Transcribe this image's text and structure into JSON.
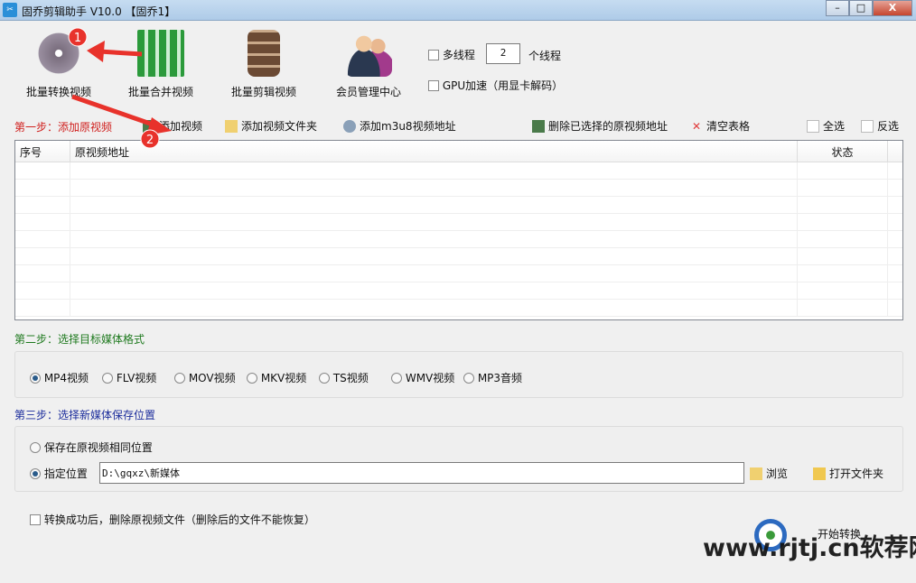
{
  "window": {
    "title": "固乔剪辑助手 V10.0 【固乔1】",
    "app_icon": "scissors-icon",
    "min": "–",
    "max": "□",
    "close": "X"
  },
  "tools": [
    {
      "label": "批量转换视频",
      "icon": "film-reel-convert-icon",
      "color": "#7a6e7e"
    },
    {
      "label": "批量合并视频",
      "icon": "merge-blocks-icon",
      "color": "#2b9a3b"
    },
    {
      "label": "批量剪辑视频",
      "icon": "film-strip-cut-icon",
      "color": "#6b4a34"
    },
    {
      "label": "会员管理中心",
      "icon": "members-icon",
      "color": "#3a6aa8"
    }
  ],
  "options": {
    "multithread_label": "多线程",
    "thread_count": "2",
    "thread_unit": "个线程",
    "gpu_label": "GPU加速（用显卡解码）"
  },
  "step1": {
    "title": "第一步：添加原视频",
    "add_video": "添加视频",
    "add_folder": "添加视频文件夹",
    "add_m3u8": "添加m3u8视频地址",
    "delete_selected": "删除已选择的原视频地址",
    "clear_table": "清空表格",
    "select_all": "全选",
    "invert": "反选"
  },
  "table": {
    "columns": [
      "序号",
      "原视频地址",
      "状态"
    ],
    "rows": []
  },
  "step2": {
    "title": "第二步：选择目标媒体格式",
    "formats": [
      "MP4视频",
      "FLV视频",
      "MOV视频",
      "MKV视频",
      "TS视频",
      "WMV视频",
      "MP3音频"
    ],
    "selected": 0
  },
  "step3": {
    "title": "第三步：选择新媒体保存位置",
    "same_location": "保存在原视频相同位置",
    "custom_location": "指定位置",
    "path": "D:\\gqxz\\新媒体",
    "browse": "浏览",
    "open_folder": "打开文件夹"
  },
  "bottom": {
    "delete_after": "转换成功后，删除原视频文件（删除后的文件不能恢复）",
    "start": "开始转换"
  },
  "annotations": {
    "badge1": "1",
    "badge2": "2"
  },
  "watermark": "www.rjtj.cn软荐网",
  "colors": {
    "step1": "#d0201e",
    "step2": "#1f7a1f",
    "step3": "#1c2d9c",
    "annotation": "#e8322b"
  }
}
